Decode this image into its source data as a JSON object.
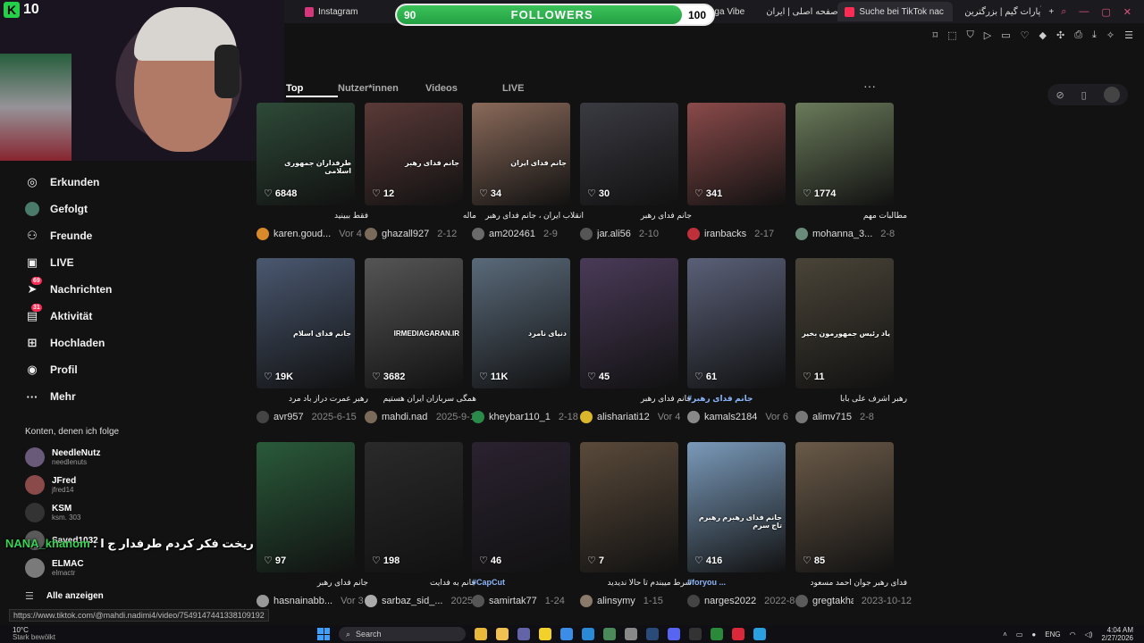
{
  "browser": {
    "tabs": [
      {
        "label": "Instagram",
        "color": "#d6367a"
      },
      {
        "label": "unaga Vibe",
        "color": "#444"
      },
      {
        "label": "صفحه اصلی | ایران",
        "color": "#3a6ee8"
      },
      {
        "label": "Suche bei TikTok nac",
        "color": "#fe2c55"
      },
      {
        "label": "آپارات گیم | بزرگترین",
        "color": "#d6367a"
      }
    ],
    "new_tab": "+",
    "status_url": "https://www.tiktok.com/@mahdi.nadimi4/video/7549147441338109192"
  },
  "overlay": {
    "kick_count": "10",
    "kick_letter": "K",
    "followers_label": "FOLLOWERS",
    "followers_current": "90",
    "followers_goal": "100",
    "followers_progress": 0.9,
    "chat_user": "NANA_khanom",
    "chat_sep": " : ",
    "chat_message": "یه دیقه چشمام ریخت فکر کردم طرفدار ج ا"
  },
  "sidebar": {
    "items": [
      {
        "label": "Erkunden",
        "icon": "compass-icon",
        "glyph": "◎"
      },
      {
        "label": "Gefolgt",
        "icon": "following-avatar-icon",
        "glyph": "●"
      },
      {
        "label": "Freunde",
        "icon": "friends-icon",
        "glyph": "⚇"
      },
      {
        "label": "LIVE",
        "icon": "live-icon",
        "glyph": "▣"
      },
      {
        "label": "Nachrichten",
        "icon": "messages-icon",
        "glyph": "➤",
        "badge": "69"
      },
      {
        "label": "Aktivität",
        "icon": "activity-icon",
        "glyph": "▤",
        "badge": "31"
      },
      {
        "label": "Hochladen",
        "icon": "upload-icon",
        "glyph": "⊞"
      },
      {
        "label": "Profil",
        "icon": "profile-icon",
        "glyph": "◉"
      },
      {
        "label": "Mehr",
        "icon": "more-icon",
        "glyph": "···"
      }
    ],
    "following_title": "Konten, denen ich folge",
    "following": [
      {
        "name": "NeedleNutz",
        "handle": "needlenuts"
      },
      {
        "name": "JFred",
        "handle": "jfred14"
      },
      {
        "name": "KSM",
        "handle": "ksm. 303"
      },
      {
        "name": "Sayed1032",
        "handle": ""
      },
      {
        "name": "ELMAC",
        "handle": "elmactr"
      }
    ],
    "show_all": "Alle anzeigen"
  },
  "search_tabs": [
    {
      "label": "Top",
      "active": true
    },
    {
      "label": "Nutzer*innen",
      "active": false
    },
    {
      "label": "Videos",
      "active": false
    },
    {
      "label": "LIVE",
      "active": false
    }
  ],
  "videos": [
    {
      "likes": "6848",
      "caption": "طرفداران جمهوری اسلامی",
      "desc": "فقط ببینید",
      "user": "karen.goud...",
      "date": "Vor 4",
      "color": "#2e4a38",
      "avatar": "#d9882a"
    },
    {
      "likes": "12",
      "caption": "جانم فدای رهبر",
      "desc": "ماله",
      "user": "ghazall927",
      "date": "2-12",
      "color": "#5a3a38",
      "avatar": "#7a6a5a"
    },
    {
      "likes": "34",
      "caption": "جانم فدای ایران",
      "desc": "انقلاب ایران ، جانم فدای رهبر",
      "user": "am202461",
      "date": "2-9",
      "color": "#8a6a5a",
      "avatar": "#6a6a6a"
    },
    {
      "likes": "30",
      "caption": "",
      "desc": "جانم فدای رهبر",
      "user": "jar.ali56",
      "date": "2-10",
      "color": "#3a3a42",
      "avatar": "#555"
    },
    {
      "likes": "341",
      "caption": "",
      "desc": "",
      "user": "iranbacks",
      "date": "2-17",
      "color": "#8a4a4a",
      "avatar": "#c0303a"
    },
    {
      "likes": "1774",
      "caption": "",
      "desc": "مطالبات مهم",
      "user": "mohanna_3...",
      "date": "2-8",
      "color": "#6a7a5a",
      "avatar": "#6a8a7a"
    },
    {
      "likes": "19K",
      "caption": "جانم فدای اسلام",
      "desc": "رهبر عمرت دراز باد مرد",
      "user": "avr957",
      "date": "2025-6-15",
      "color": "#4a5870",
      "avatar": "#444"
    },
    {
      "likes": "3682",
      "caption": "IRMEDIAGARAN.IR",
      "desc": "همگی سربازان ایران هستیم",
      "user": "mahdi.nadi...",
      "date": "2025-9-12",
      "color": "#555555",
      "avatar": "#7a6a5a"
    },
    {
      "likes": "11K",
      "caption": "دنیای نامرد",
      "desc": "",
      "user": "kheybar110_1",
      "date": "2-18",
      "color": "#5a6a7a",
      "avatar": "#2a8a4a"
    },
    {
      "likes": "45",
      "caption": "",
      "desc": "جانم فدای رهبر",
      "user": "alishariati12",
      "date": "Vor 4",
      "color": "#4a3a58",
      "avatar": "#d9b62a"
    },
    {
      "likes": "61",
      "caption": "",
      "desc": "#جانم فدای رهبر",
      "user": "kamals2184",
      "date": "Vor 6",
      "color": "#5a6078",
      "avatar": "#888"
    },
    {
      "likes": "11",
      "caption": "یاد رئیس جمهورمون بخیر",
      "desc": "رهبر اشرف علی بابا",
      "user": "alimv715",
      "date": "2-8",
      "color": "#4a4438",
      "avatar": "#777"
    },
    {
      "likes": "97",
      "caption": "",
      "desc": "جانم فدای رهبر",
      "user": "hasnainabb...",
      "date": "Vor 3",
      "color": "#2a5a3a",
      "avatar": "#999"
    },
    {
      "likes": "198",
      "caption": "",
      "desc": "جانم به فدایت",
      "user": "sarbaz_sid_...",
      "date": "2025",
      "color": "#2a2a2a",
      "avatar": "#aaa"
    },
    {
      "likes": "46",
      "caption": "",
      "desc": "#CapCut",
      "user": "samirtak77",
      "date": "1-24",
      "color": "#2a2230",
      "avatar": "#555"
    },
    {
      "likes": "7",
      "caption": "",
      "desc": "شرط میبندم تا حالا ندیدید",
      "user": "alinsymy",
      "date": "1-15",
      "color": "#5a4a3a",
      "avatar": "#8a7a6a"
    },
    {
      "likes": "416",
      "caption": "جانم فدای رهبرم رهبرم تاج سرم",
      "desc": "#foryou ...",
      "user": "narges2022",
      "date": "2022-8-",
      "color": "#7a9aba",
      "avatar": "#444"
    },
    {
      "likes": "85",
      "caption": "",
      "desc": "فدای رهبر جوان احمد مسعود",
      "user": "gregtakhar...",
      "date": "2023-10-12",
      "color": "#6a5a48",
      "avatar": "#5a5a5a"
    }
  ],
  "taskbar": {
    "weather_temp": "10°C",
    "weather_desc": "Stark bewölkt",
    "search_label": "Search",
    "time": "4:04 AM",
    "date": "2/27/2026",
    "lang": "ENG"
  }
}
